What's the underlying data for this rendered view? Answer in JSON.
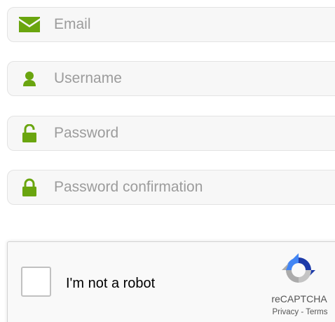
{
  "colors": {
    "accent": "#6aa50f",
    "field_bg": "#f7f7f7",
    "placeholder": "#9c9c9c"
  },
  "form": {
    "email": {
      "placeholder": "Email",
      "value": "",
      "icon": "envelope-icon"
    },
    "username": {
      "placeholder": "Username",
      "value": "",
      "icon": "user-icon"
    },
    "password": {
      "placeholder": "Password",
      "value": "",
      "icon": "unlock-icon"
    },
    "password_confirmation": {
      "placeholder": "Password confirmation",
      "value": "",
      "icon": "lock-icon"
    }
  },
  "captcha": {
    "label": "I'm not a robot",
    "brand": "reCAPTCHA",
    "privacy": "Privacy",
    "separator": " - ",
    "terms": "Terms",
    "icon": "recaptcha-logo-icon"
  }
}
